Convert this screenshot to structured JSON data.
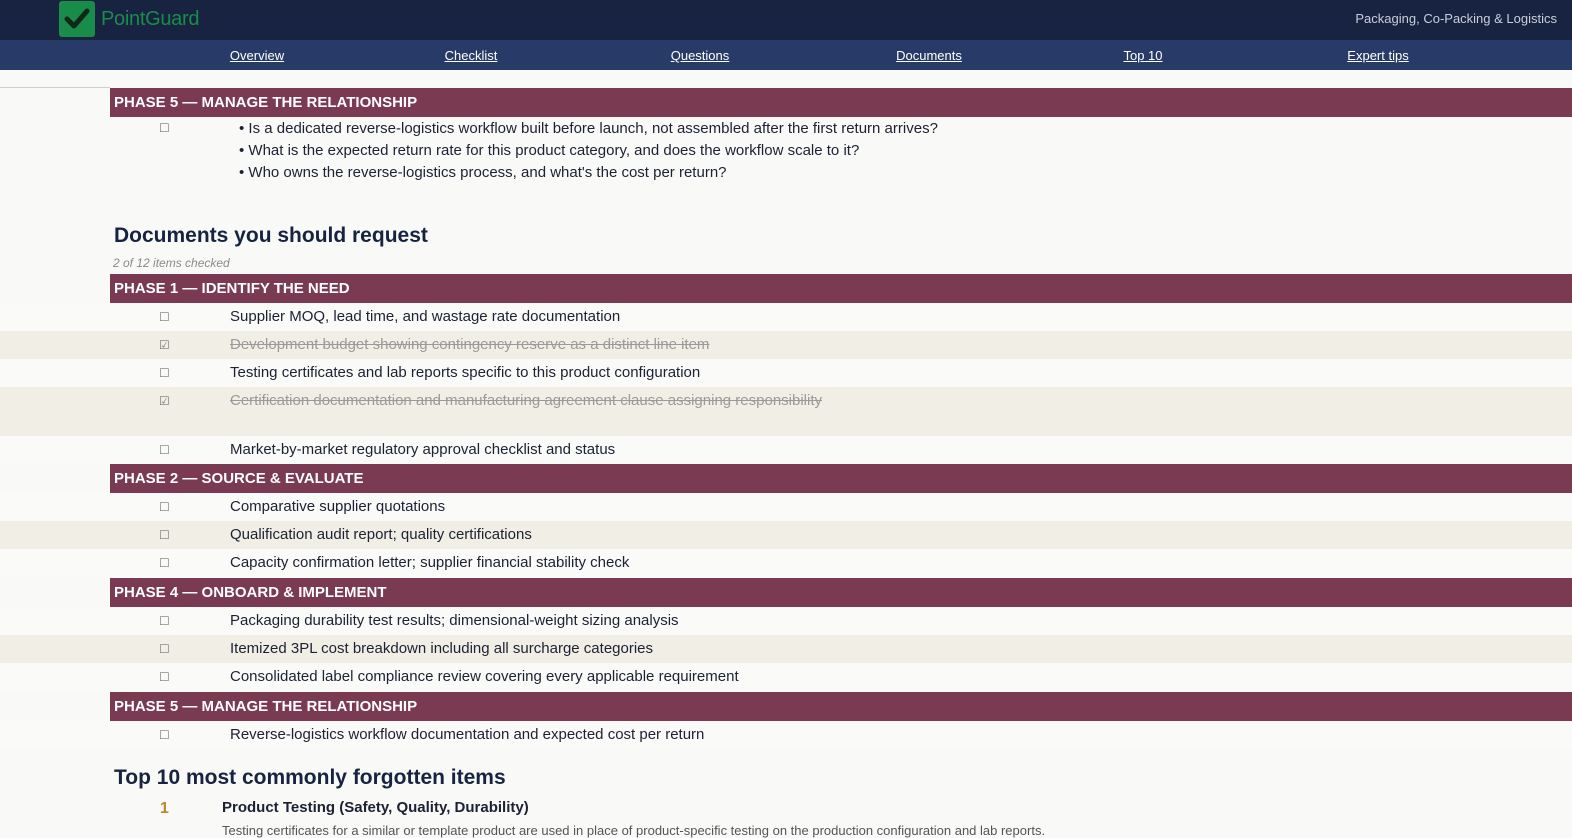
{
  "app": {
    "brand": "PointGuard",
    "category": "Packaging, Co-Packing & Logistics",
    "colors": {
      "header": "#172340",
      "nav": "#283b68",
      "brand_green": "#1a8c4a",
      "phase": "#7a3a52",
      "accent_gold": "#b8882a"
    }
  },
  "nav": [
    "Overview",
    "Checklist",
    "Questions",
    "Documents",
    "Top 10",
    "Expert tips"
  ],
  "questions_section": {
    "phase_title": "PHASE 5 — MANAGE THE RELATIONSHIP",
    "checkbox": "☐",
    "lines": [
      "• Is a dedicated reverse-logistics workflow built before launch, not assembled after the first return arrives?",
      "• What is the expected return rate for this product category, and does the workflow scale to it?",
      "• Who owns the reverse-logistics process, and what's the cost per return?"
    ]
  },
  "documents": {
    "heading": "Documents you should request",
    "count": "2 of 12 items checked",
    "phases": [
      {
        "title": "PHASE 1 — IDENTIFY THE NEED",
        "items": [
          {
            "box": "☐",
            "text": "Supplier MOQ, lead time, and wastage rate documentation",
            "done": false
          },
          {
            "box": "☑",
            "text": "Development budget showing contingency reserve as a distinct line item",
            "done": true
          },
          {
            "box": "☐",
            "text": "Testing certificates and lab reports specific to this product configuration",
            "done": false
          },
          {
            "box": "☑",
            "text": "Certification documentation and manufacturing agreement clause assigning responsibility",
            "done": true
          },
          {
            "box": "☐",
            "text": "Market-by-market regulatory approval checklist and status",
            "done": false
          }
        ]
      },
      {
        "title": "PHASE 2 — SOURCE & EVALUATE",
        "items": [
          {
            "box": "☐",
            "text": "Comparative supplier quotations",
            "done": false
          },
          {
            "box": "☐",
            "text": "Qualification audit report; quality certifications",
            "done": false
          },
          {
            "box": "☐",
            "text": "Capacity confirmation letter; supplier financial stability check",
            "done": false
          }
        ]
      },
      {
        "title": "PHASE 4 — ONBOARD & IMPLEMENT",
        "items": [
          {
            "box": "☐",
            "text": "Packaging durability test results; dimensional-weight sizing analysis",
            "done": false
          },
          {
            "box": "☐",
            "text": "Itemized 3PL cost breakdown including all surcharge categories",
            "done": false
          },
          {
            "box": "☐",
            "text": "Consolidated label compliance review covering every applicable requirement",
            "done": false
          }
        ]
      },
      {
        "title": "PHASE 5 — MANAGE THE RELATIONSHIP",
        "items": [
          {
            "box": "☐",
            "text": "Reverse-logistics workflow documentation and expected cost per return",
            "done": false
          }
        ]
      }
    ]
  },
  "top10": {
    "heading": "Top 10 most commonly forgotten items",
    "items": [
      {
        "num": "1",
        "title": "Product Testing (Safety, Quality, Durability)",
        "desc": "Testing certificates for a similar or template product are used in place of product-specific testing on the production configuration and lab reports."
      }
    ]
  }
}
